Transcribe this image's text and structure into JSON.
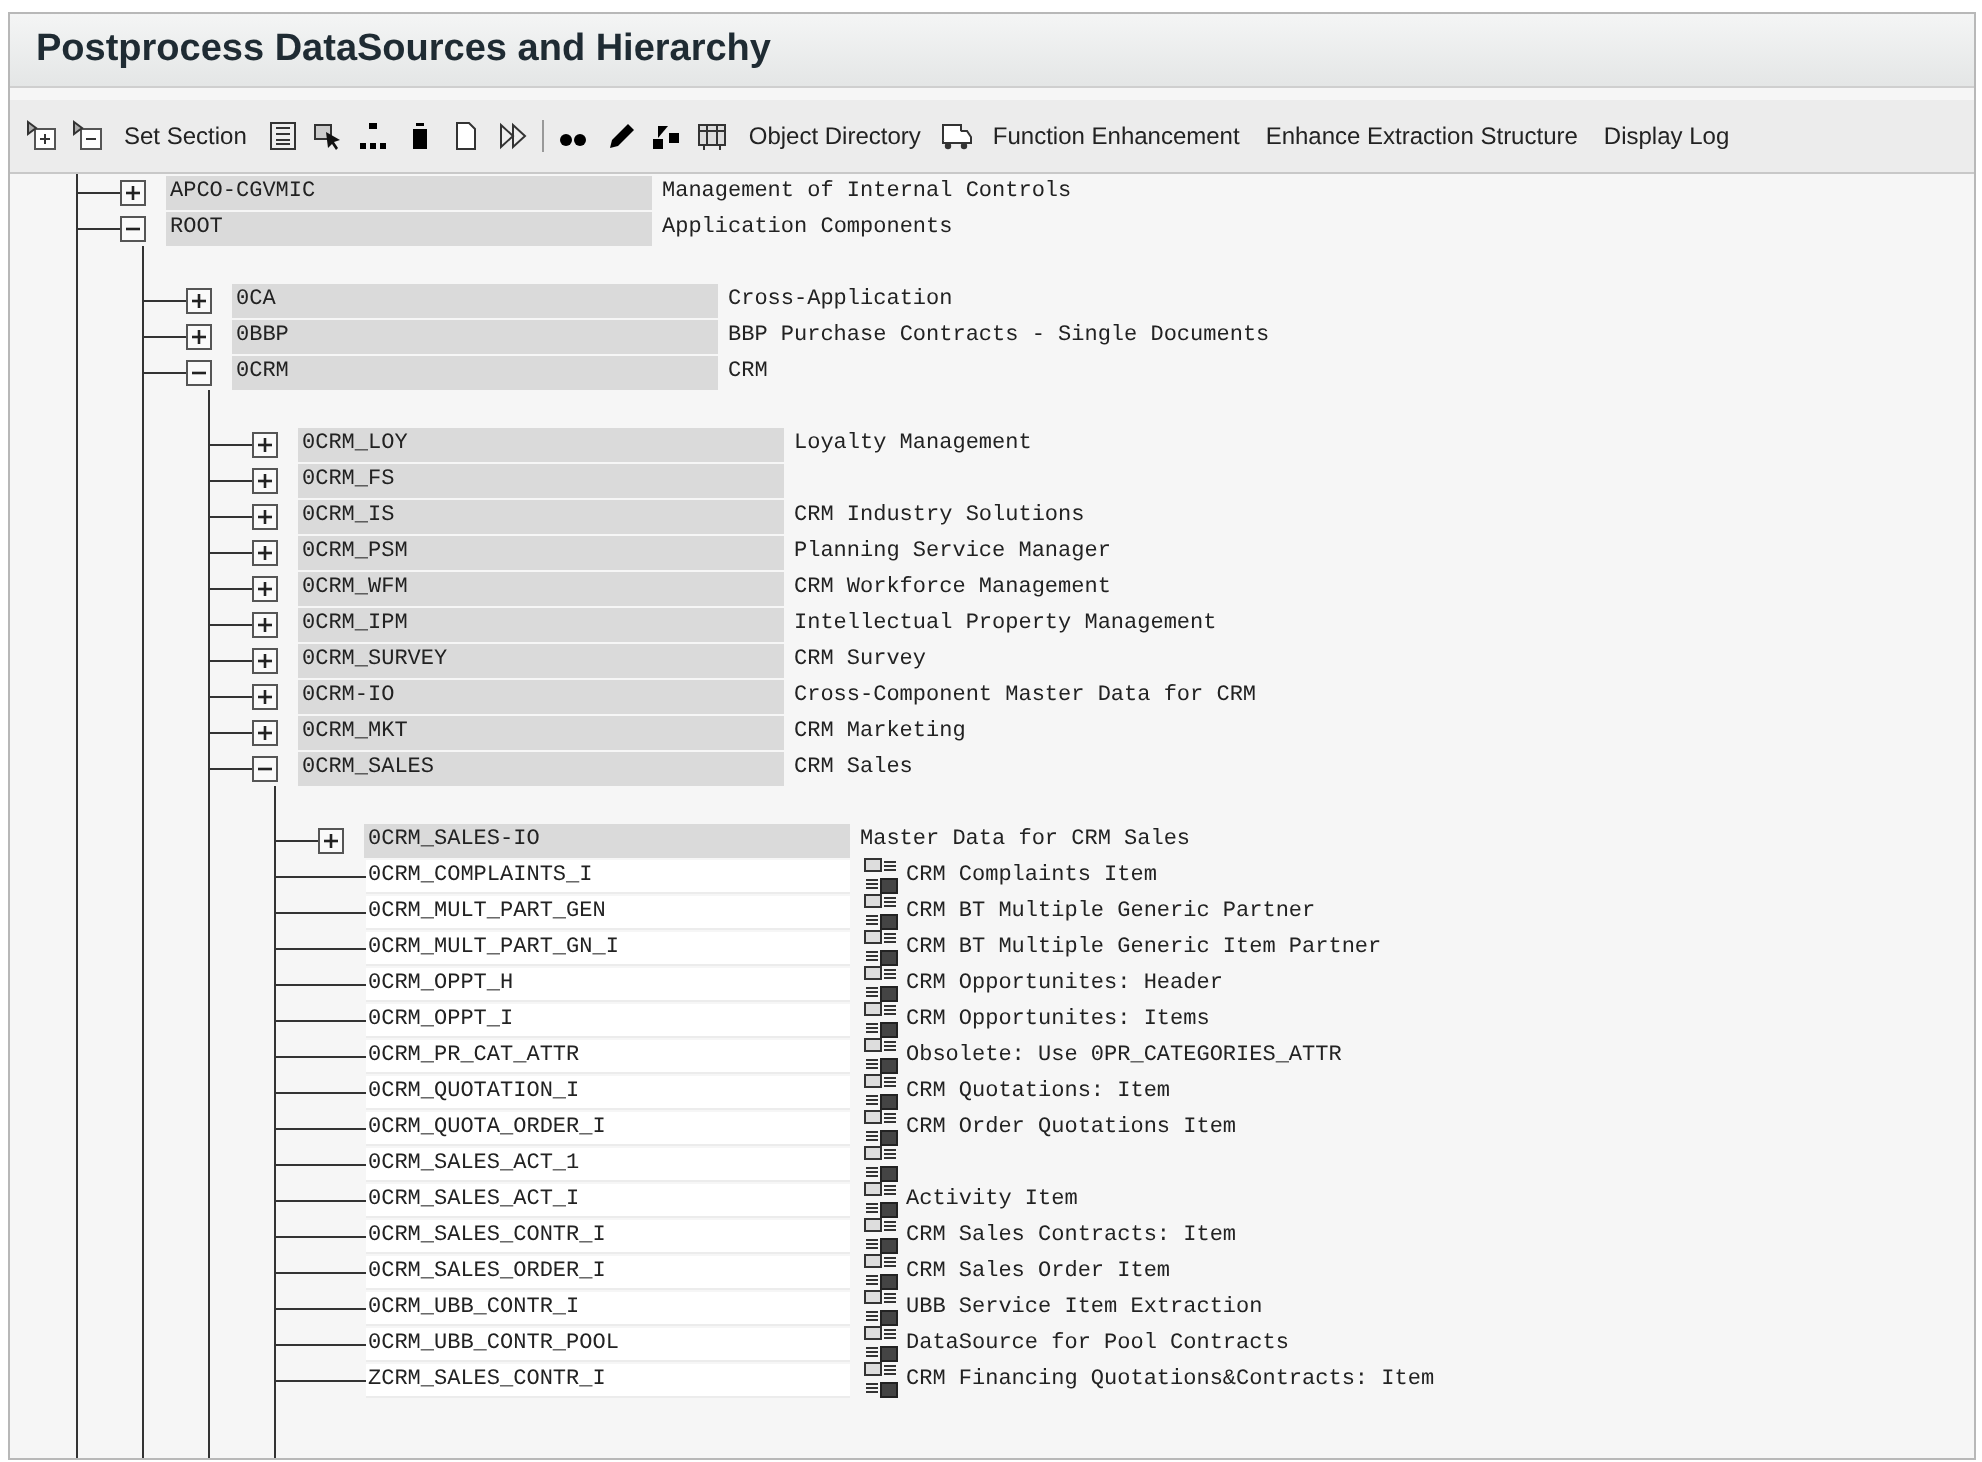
{
  "title": "Postprocess DataSources and Hierarchy",
  "toolbar": {
    "labels": [
      "Set Section",
      "Object Directory",
      "Function Enhancement",
      "Enhance Extraction Structure",
      "Display Log"
    ]
  },
  "tree": [
    {
      "kind": "folder",
      "name": "APCO-CGVMIC",
      "description": "Management of Internal Controls",
      "expanded": false
    },
    {
      "kind": "folder",
      "name": "ROOT",
      "description": "Application Components",
      "expanded": true,
      "children": [
        {
          "kind": "folder",
          "name": "0CA",
          "description": "Cross-Application",
          "expanded": false
        },
        {
          "kind": "folder",
          "name": "0BBP",
          "description": "BBP Purchase Contracts - Single Documents",
          "expanded": false
        },
        {
          "kind": "folder",
          "name": "0CRM",
          "description": "CRM",
          "expanded": true,
          "children": [
            {
              "kind": "folder",
              "name": "0CRM_LOY",
              "description": "Loyalty Management",
              "expanded": false
            },
            {
              "kind": "folder",
              "name": "0CRM_FS",
              "expanded": false
            },
            {
              "kind": "folder",
              "name": "0CRM_IS",
              "description": "CRM Industry Solutions",
              "expanded": false
            },
            {
              "kind": "folder",
              "name": "0CRM_PSM",
              "description": "Planning Service Manager",
              "expanded": false
            },
            {
              "kind": "folder",
              "name": "0CRM_WFM",
              "description": "CRM Workforce Management",
              "expanded": false
            },
            {
              "kind": "folder",
              "name": "0CRM_IPM",
              "description": "Intellectual Property Management",
              "expanded": false
            },
            {
              "kind": "folder",
              "name": "0CRM_SURVEY",
              "description": "CRM Survey",
              "expanded": false
            },
            {
              "kind": "folder",
              "name": "0CRM-IO",
              "description": "Cross-Component Master Data for CRM",
              "expanded": false
            },
            {
              "kind": "folder",
              "name": "0CRM_MKT",
              "description": "CRM Marketing",
              "expanded": false
            },
            {
              "kind": "folder",
              "name": "0CRM_SALES",
              "description": "CRM Sales",
              "expanded": true,
              "children": [
                {
                  "kind": "folder",
                  "name": "0CRM_SALES-IO",
                  "description": "Master Data for CRM Sales",
                  "expanded": false
                },
                {
                  "kind": "datasource",
                  "name": "0CRM_COMPLAINTS_I",
                  "description": "CRM Complaints Item"
                },
                {
                  "kind": "datasource",
                  "name": "0CRM_MULT_PART_GEN",
                  "description": "CRM BT Multiple Generic Partner"
                },
                {
                  "kind": "datasource",
                  "name": "0CRM_MULT_PART_GN_I",
                  "description": "CRM BT Multiple Generic Item Partner"
                },
                {
                  "kind": "datasource",
                  "name": "0CRM_OPPT_H",
                  "description": "CRM Opportunites: Header"
                },
                {
                  "kind": "datasource",
                  "name": "0CRM_OPPT_I",
                  "description": "CRM Opportunites: Items"
                },
                {
                  "kind": "datasource",
                  "name": "0CRM_PR_CAT_ATTR",
                  "description": "Obsolete: Use 0PR_CATEGORIES_ATTR"
                },
                {
                  "kind": "datasource",
                  "name": "0CRM_QUOTATION_I",
                  "description": "CRM Quotations: Item"
                },
                {
                  "kind": "datasource",
                  "name": "0CRM_QUOTA_ORDER_I",
                  "description": "CRM Order Quotations Item"
                },
                {
                  "kind": "datasource",
                  "name": "0CRM_SALES_ACT_1"
                },
                {
                  "kind": "datasource",
                  "name": "0CRM_SALES_ACT_I",
                  "description": "Activity Item"
                },
                {
                  "kind": "datasource",
                  "name": "0CRM_SALES_CONTR_I",
                  "description": "CRM Sales Contracts: Item"
                },
                {
                  "kind": "datasource",
                  "name": "0CRM_SALES_ORDER_I",
                  "description": "CRM Sales Order Item"
                },
                {
                  "kind": "datasource",
                  "name": "0CRM_UBB_CONTR_I",
                  "description": "UBB Service Item Extraction"
                },
                {
                  "kind": "datasource",
                  "name": "0CRM_UBB_CONTR_POOL",
                  "description": "DataSource for Pool Contracts"
                },
                {
                  "kind": "datasource",
                  "name": "ZCRM_SALES_CONTR_I",
                  "description": "CRM Financing Quotations&Contracts: Item"
                }
              ]
            }
          ]
        }
      ]
    }
  ]
}
